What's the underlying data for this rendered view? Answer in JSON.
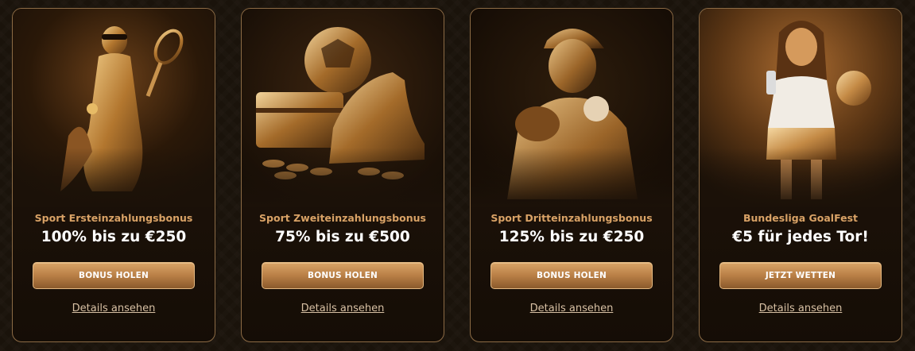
{
  "cards": [
    {
      "subtitle": "Sport Ersteinzahlungsbonus",
      "title": "100% bis zu €250",
      "button": "BONUS HOLEN",
      "link": "Details ansehen"
    },
    {
      "subtitle": "Sport Zweiteinzahlungsbonus",
      "title": "75% bis zu €500",
      "button": "BONUS HOLEN",
      "link": "Details ansehen"
    },
    {
      "subtitle": "Sport Dritteinzahlungsbonus",
      "title": "125% bis zu €250",
      "button": "BONUS HOLEN",
      "link": "Details ansehen"
    },
    {
      "subtitle": "Bundesliga GoalFest",
      "title": "€5 für jedes Tor!",
      "button": "JETZT WETTEN",
      "link": "Details ansehen"
    }
  ],
  "colors": {
    "accent": "#d9a266",
    "button_gold": "#c58f53",
    "border": "#8c6b45",
    "background": "#1a130b"
  }
}
